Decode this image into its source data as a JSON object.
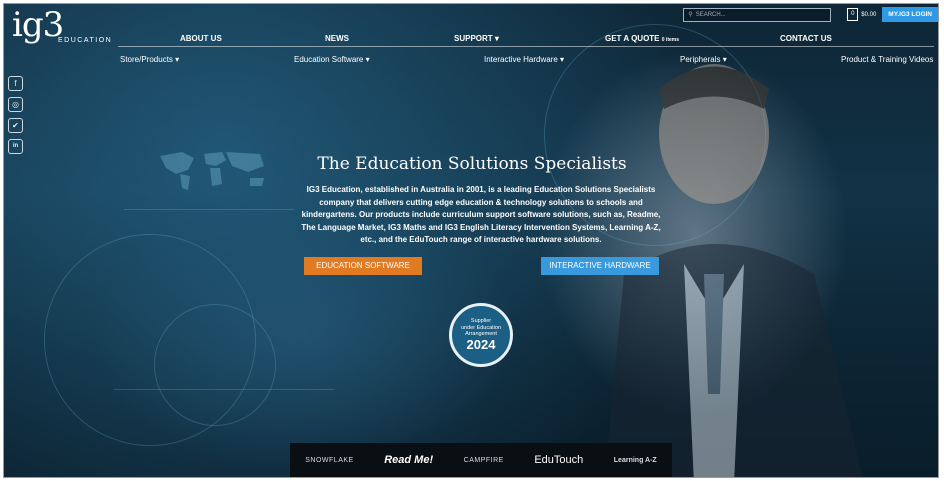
{
  "logo": {
    "big": "ig3",
    "small": "EDUCATION"
  },
  "topbar": {
    "search_placeholder": "SEARCH...",
    "cart_count": "0",
    "cart_amount": "$0.00",
    "login_label": "MY.IG3 LOGIN"
  },
  "nav_primary": [
    {
      "label": "ABOUT US"
    },
    {
      "label": "NEWS"
    },
    {
      "label": "SUPPORT"
    },
    {
      "label": "GET A QUOTE",
      "suffix": "0 items"
    },
    {
      "label": "CONTACT US"
    }
  ],
  "nav_secondary": [
    {
      "label": "Store/Products"
    },
    {
      "label": "Education Software"
    },
    {
      "label": "Interactive Hardware"
    },
    {
      "label": "Peripherals"
    },
    {
      "label": "Product & Training Videos"
    }
  ],
  "social": [
    {
      "icon": "facebook-icon",
      "glyph": "f"
    },
    {
      "icon": "instagram-icon",
      "glyph": "◎"
    },
    {
      "icon": "twitter-icon",
      "glyph": "✔"
    },
    {
      "icon": "linkedin-icon",
      "glyph": "in"
    }
  ],
  "hero": {
    "title": "The Education Solutions Specialists",
    "body": "IG3 Education, established in Australia in 2001, is a leading Education Solutions Specialists company that delivers cutting edge education & technology solutions to schools and kindergartens. Our products include curriculum support software solutions, such as, Readme, The Language Market, IG3 Maths and IG3 English Literacy Intervention Systems, Learning A-Z, etc., and the EduTouch range of interactive hardware solutions.",
    "btn_software": "EDUCATION SOFTWARE",
    "btn_hardware": "INTERACTIVE HARDWARE"
  },
  "badge": {
    "line1": "Supplier",
    "line2": "under Education",
    "line3": "Arrangement",
    "year": "2024"
  },
  "partners": [
    "SNOWFLAKE",
    "Read Me!",
    "CAMPFIRE",
    "EduTouch",
    "Learning A-Z"
  ],
  "colors": {
    "accent_orange": "#e07b24",
    "accent_blue": "#3899dd",
    "login_blue": "#2e9ae6",
    "hero_bg": "#123246"
  }
}
